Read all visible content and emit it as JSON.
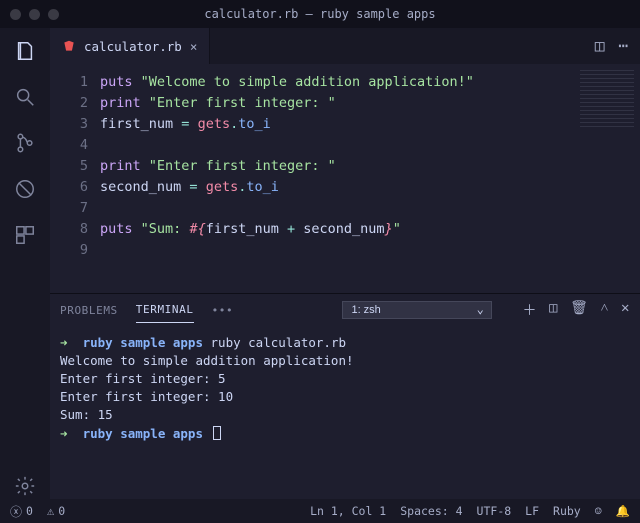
{
  "window": {
    "title": "calculator.rb — ruby sample apps"
  },
  "tabs": [
    {
      "label": "calculator.rb"
    }
  ],
  "code_lines": [
    {
      "n": "1",
      "html": "<span class=\"tok-kw\">puts</span> <span class=\"tok-str\">\"Welcome to simple addition application!\"</span>"
    },
    {
      "n": "2",
      "html": "<span class=\"tok-kw\">print</span> <span class=\"tok-str\">\"Enter first integer: \"</span>"
    },
    {
      "n": "3",
      "html": "<span class=\"tok-var\">first_num</span> <span class=\"tok-op\">=</span> <span class=\"tok-obj\">gets</span><span class=\"tok-op\">.</span><span class=\"tok-call\">to_i</span>"
    },
    {
      "n": "4",
      "html": ""
    },
    {
      "n": "5",
      "html": "<span class=\"tok-kw\">print</span> <span class=\"tok-str\">\"Enter first integer: \"</span>"
    },
    {
      "n": "6",
      "html": "<span class=\"tok-var\">second_num</span> <span class=\"tok-op\">=</span> <span class=\"tok-obj\">gets</span><span class=\"tok-op\">.</span><span class=\"tok-call\">to_i</span>"
    },
    {
      "n": "7",
      "html": ""
    },
    {
      "n": "8",
      "html": "<span class=\"tok-kw\">puts</span> <span class=\"tok-str\">\"Sum: </span><span class=\"tok-int\">#{</span><span class=\"tok-var\">first_num</span> <span class=\"tok-op\">+</span> <span class=\"tok-var\">second_num</span><span class=\"tok-int\">}</span><span class=\"tok-str\">\"</span>"
    },
    {
      "n": "9",
      "html": ""
    }
  ],
  "panel": {
    "tabs": {
      "problems": "PROBLEMS",
      "terminal": "TERMINAL",
      "more": "•••"
    },
    "shell_select": "1: zsh",
    "terminal_lines": [
      {
        "type": "prompt",
        "cwd": "ruby sample apps",
        "cmd": "ruby calculator.rb"
      },
      {
        "type": "out",
        "text": "Welcome to simple addition application!"
      },
      {
        "type": "out",
        "text": "Enter first integer: 5"
      },
      {
        "type": "out",
        "text": "Enter first integer: 10"
      },
      {
        "type": "out",
        "text": "Sum: 15"
      },
      {
        "type": "prompt",
        "cwd": "ruby sample apps",
        "cmd": ""
      }
    ]
  },
  "status": {
    "errors": "0",
    "warnings": "0",
    "position": "Ln 1, Col 1",
    "spaces": "Spaces: 4",
    "encoding": "UTF-8",
    "eol": "LF",
    "lang": "Ruby"
  }
}
